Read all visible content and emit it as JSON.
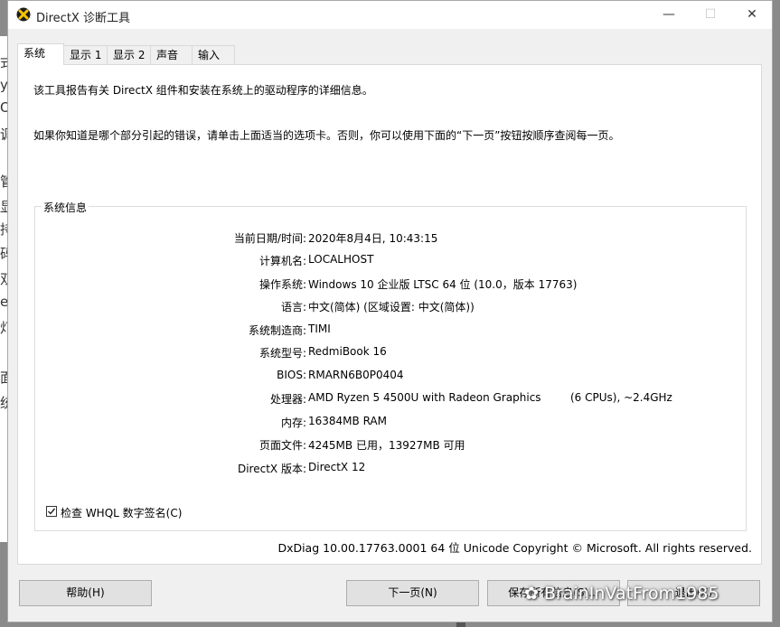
{
  "window": {
    "title": "DirectX 诊断工具",
    "controls": {
      "minimize": "—",
      "maximize": "☐",
      "close": "✕"
    }
  },
  "tabs": [
    {
      "label": "系统",
      "active": true
    },
    {
      "label": "显示 1",
      "active": false
    },
    {
      "label": "显示 2",
      "active": false
    },
    {
      "label": "声音",
      "active": false
    },
    {
      "label": "输入",
      "active": false
    }
  ],
  "intro": {
    "line1": "该工具报告有关 DirectX 组件和安装在系统上的驱动程序的详细信息。",
    "line2": "如果你知道是哪个部分引起的错误，请单击上面适当的选项卡。否则，你可以使用下面的“下一页”按钮按顺序查阅每一页。"
  },
  "system_info": {
    "legend": "系统信息",
    "rows": [
      {
        "label": "当前日期/时间:",
        "value": "2020年8月4日, 10:43:15"
      },
      {
        "label": "计算机名:",
        "value": "LOCALHOST"
      },
      {
        "label": "操作系统:",
        "value": "Windows 10 企业版 LTSC 64 位 (10.0，版本 17763)"
      },
      {
        "label": "语言:",
        "value": "中文(简体) (区域设置: 中文(简体))"
      },
      {
        "label": "系统制造商:",
        "value": "TIMI"
      },
      {
        "label": "系统型号:",
        "value": "RedmiBook 16"
      },
      {
        "label": "BIOS:",
        "value": "RMARN6B0P0404"
      },
      {
        "label": "处理器:",
        "value": "AMD Ryzen 5 4500U with Radeon Graphics",
        "extra": "(6 CPUs), ~2.4GHz"
      },
      {
        "label": "内存:",
        "value": "16384MB RAM"
      },
      {
        "label": "页面文件:",
        "value": "4245MB 已用，13927MB 可用"
      },
      {
        "label": "DirectX 版本:",
        "value": "DirectX 12"
      }
    ],
    "whql_checkbox": {
      "label": "检查 WHQL 数字签名(C)",
      "checked": true
    }
  },
  "footer": "DxDiag 10.00.17763.0001 64 位 Unicode  Copyright © Microsoft. All rights reserved.",
  "buttons": {
    "help": "帮助(H)",
    "next": "下一页(N)",
    "save": "保存所有信息(S)...",
    "exit": "退出(X)"
  },
  "watermark": "BrainInVatFrom1985",
  "background_window_glyphs": [
    "式",
    "y",
    "O",
    "调",
    "管",
    "显",
    "持",
    "码",
    "双",
    "e",
    "灯",
    "面",
    "统"
  ]
}
